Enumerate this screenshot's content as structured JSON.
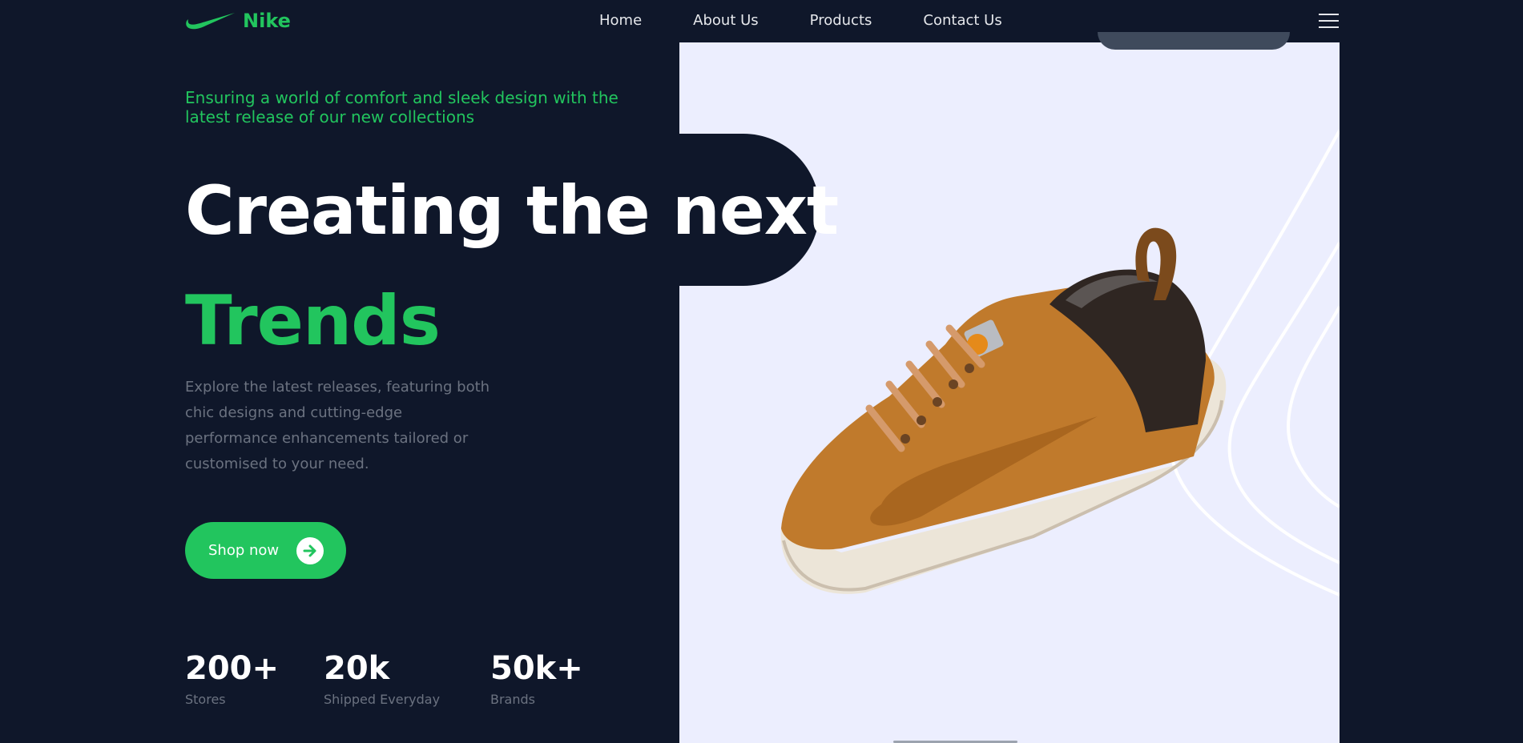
{
  "brand": {
    "name": "Nike",
    "logo_icon": "nike-swoosh-icon",
    "accent_color": "#22c55e"
  },
  "nav": {
    "links": [
      {
        "label": "Home"
      },
      {
        "label": "About Us"
      },
      {
        "label": "Products"
      },
      {
        "label": "Contact Us"
      }
    ],
    "menu_icon": "hamburger-menu-icon"
  },
  "hero": {
    "tagline": "Ensuring a world of comfort and sleek design with the latest release of our new collections",
    "headline": "Creating the next",
    "headline_accent": "Trends",
    "description": "Explore the latest releases, featuring both chic designs and cutting-edge performance enhancements tailored or customised to your need.",
    "cta": {
      "label": "Shop now",
      "icon": "arrow-right-icon"
    },
    "image": "sneaker-image"
  },
  "stats": [
    {
      "value": "200+",
      "label": "Stores"
    },
    {
      "value": "20k",
      "label": "Shipped Everyday"
    },
    {
      "value": "50k+",
      "label": "Brands"
    }
  ],
  "colors": {
    "background": "#0f172a",
    "panel": "#eceefe",
    "text": "#ffffff",
    "muted": "#6b7280"
  }
}
